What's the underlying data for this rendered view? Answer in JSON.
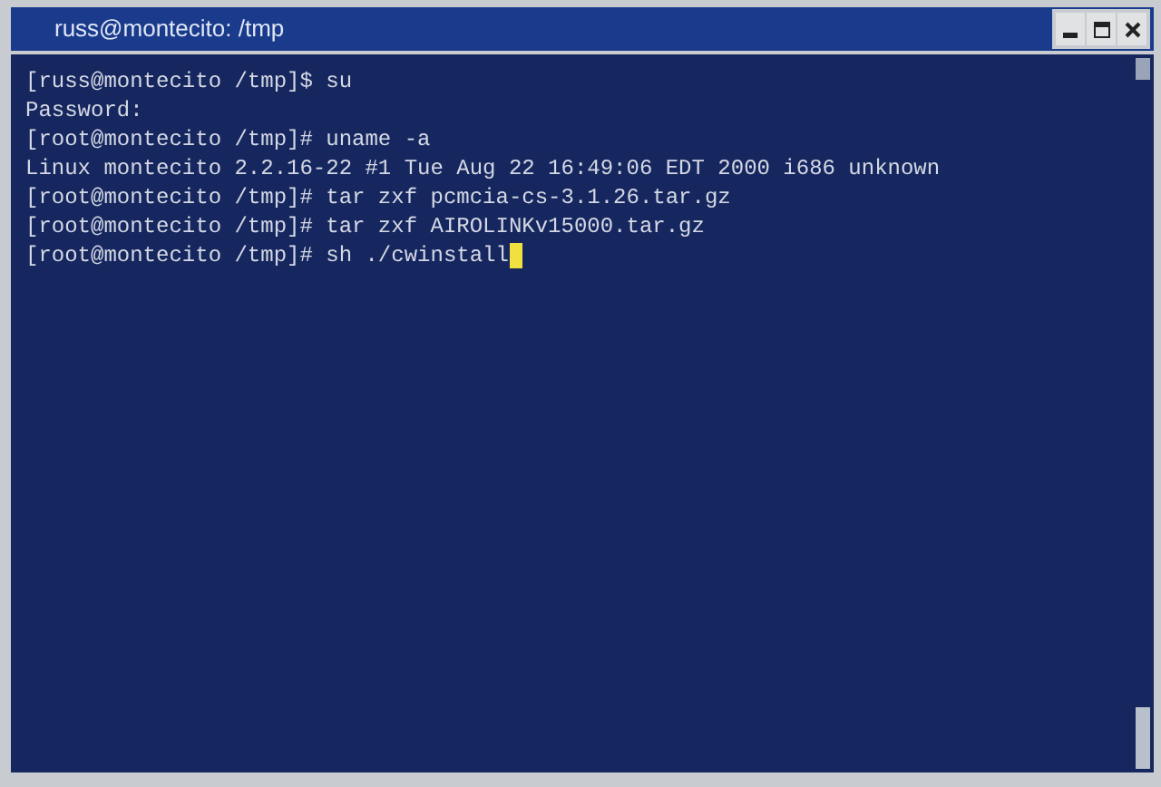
{
  "window": {
    "title": "russ@montecito: /tmp"
  },
  "terminal": {
    "lines": [
      "[russ@montecito /tmp]$ su",
      "Password:",
      "[root@montecito /tmp]# uname -a",
      "Linux montecito 2.2.16-22 #1 Tue Aug 22 16:49:06 EDT 2000 i686 unknown",
      "[root@montecito /tmp]# tar zxf pcmcia-cs-3.1.26.tar.gz",
      "[root@montecito /tmp]# tar zxf AIROLINKv15000.tar.gz",
      "[root@montecito /tmp]# sh ./cwinstall"
    ],
    "cursor": true
  }
}
